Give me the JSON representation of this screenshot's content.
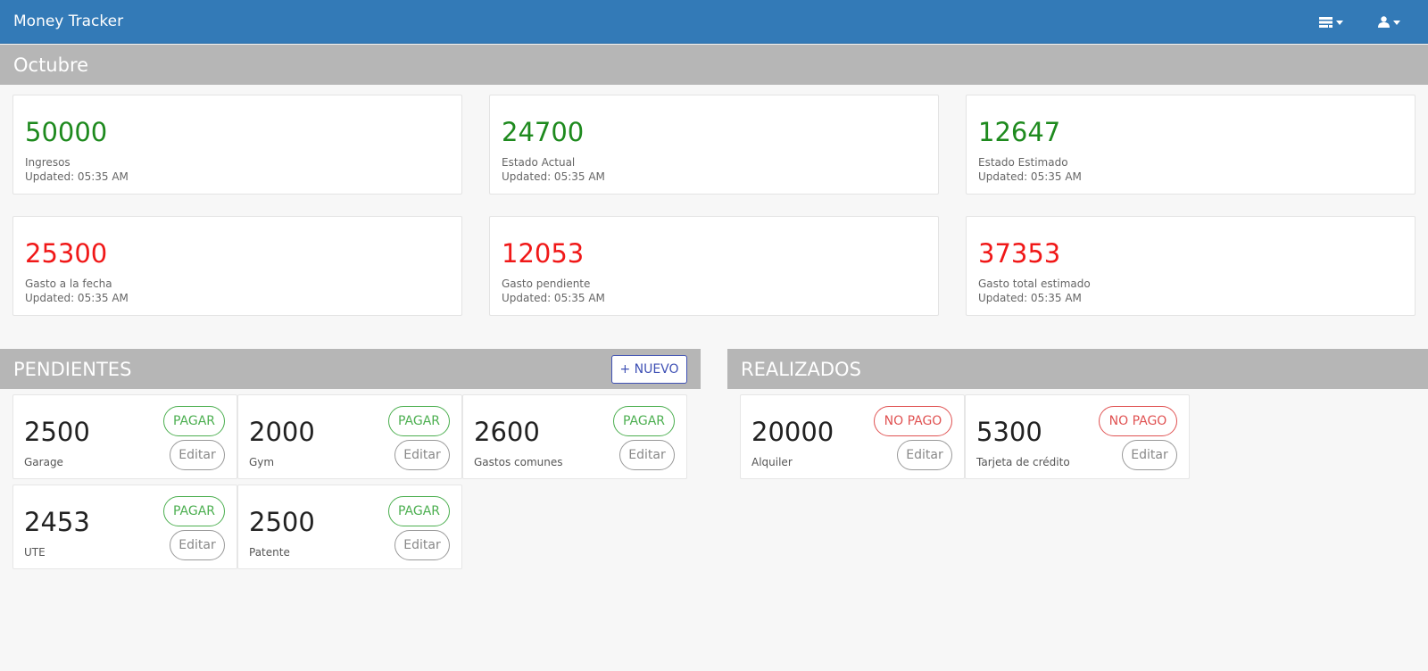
{
  "app": {
    "title": "Money Tracker"
  },
  "month": {
    "title": "Octubre"
  },
  "stats": [
    {
      "value": "50000",
      "label": "Ingresos",
      "updated": "Updated:  05:35 AM",
      "color": "#1e8a1e"
    },
    {
      "value": "24700",
      "label": "Estado Actual",
      "updated": "Updated:  05:35 AM",
      "color": "#1e8a1e"
    },
    {
      "value": "12647",
      "label": "Estado Estimado",
      "updated": "Updated:  05:35 AM",
      "color": "#1e8a1e"
    },
    {
      "value": "25300",
      "label": "Gasto a la fecha",
      "updated": "Updated:  05:35 AM",
      "color": "#f01818"
    },
    {
      "value": "12053",
      "label": "Gasto pendiente",
      "updated": "Updated:  05:35 AM",
      "color": "#f01818"
    },
    {
      "value": "37353",
      "label": "Gasto total estimado",
      "updated": "Updated:  05:35 AM",
      "color": "#f01818"
    }
  ],
  "pendientes": {
    "title": "PENDIENTES",
    "new_label": "+ NUEVO",
    "items": [
      {
        "amount": "2500",
        "name": "Garage",
        "action": "PAGAR",
        "edit": "Editar"
      },
      {
        "amount": "2000",
        "name": "Gym",
        "action": "PAGAR",
        "edit": "Editar"
      },
      {
        "amount": "2600",
        "name": "Gastos comunes",
        "action": "PAGAR",
        "edit": "Editar"
      },
      {
        "amount": "2453",
        "name": "UTE",
        "action": "PAGAR",
        "edit": "Editar"
      },
      {
        "amount": "2500",
        "name": "Patente",
        "action": "PAGAR",
        "edit": "Editar"
      }
    ]
  },
  "realizados": {
    "title": "REALIZADOS",
    "items": [
      {
        "amount": "20000",
        "name": "Alquiler",
        "action": "NO PAGO",
        "edit": "Editar"
      },
      {
        "amount": "5300",
        "name": "Tarjeta de crédito",
        "action": "NO PAGO",
        "edit": "Editar"
      }
    ]
  },
  "nav": {
    "report_icon": "report-icon",
    "user_icon": "user-icon"
  },
  "colors": {
    "navbar": "#337ab7",
    "section": "#b6b6b6",
    "income": "#1e8a1e",
    "expense": "#f01818",
    "pay": "#4caf50",
    "unpay": "#e05252",
    "new": "#3f51b5"
  }
}
